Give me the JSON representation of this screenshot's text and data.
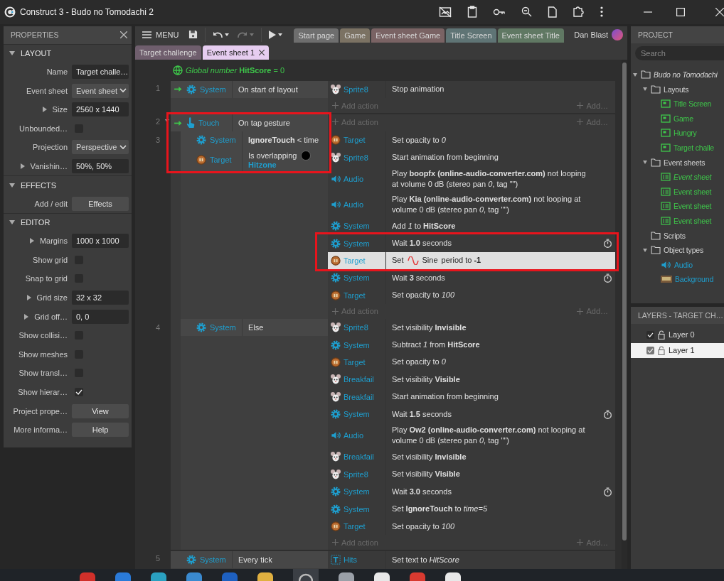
{
  "window": {
    "title": "Construct 3 - Budo no Tomodachi 2"
  },
  "properties": {
    "title": "PROPERTIES",
    "sections": [
      {
        "title": "LAYOUT",
        "expanded": true,
        "rows": [
          {
            "label": "Name",
            "kind": "field",
            "value": "Target challe…"
          },
          {
            "label": "Event sheet",
            "kind": "select",
            "value": "Event sheet"
          },
          {
            "label": "Size",
            "kind": "field",
            "value": "2560 x 1440",
            "expandable": true
          },
          {
            "label": "Unbounded…",
            "kind": "check",
            "checked": false
          },
          {
            "label": "Projection",
            "kind": "select",
            "value": "Perspective"
          },
          {
            "label": "Vanishin…",
            "kind": "field",
            "value": "50%, 50%",
            "expandable": true
          }
        ]
      },
      {
        "title": "EFFECTS",
        "expanded": true,
        "rows": [
          {
            "label": "Add / edit",
            "kind": "button",
            "value": "Effects"
          }
        ]
      },
      {
        "title": "EDITOR",
        "expanded": true,
        "rows": [
          {
            "label": "Margins",
            "kind": "field",
            "value": "1000 x 1000",
            "expandable": true
          },
          {
            "label": "Show grid",
            "kind": "check",
            "checked": false
          },
          {
            "label": "Snap to grid",
            "kind": "check",
            "checked": false
          },
          {
            "label": "Grid size",
            "kind": "field",
            "value": "32 x 32",
            "expandable": true
          },
          {
            "label": "Grid off…",
            "kind": "field",
            "value": "0, 0",
            "expandable": true
          },
          {
            "label": "Show collisi…",
            "kind": "check",
            "checked": false
          },
          {
            "label": "Show meshes",
            "kind": "check",
            "checked": false
          },
          {
            "label": "Show transl…",
            "kind": "check",
            "checked": false
          },
          {
            "label": "Show hierar…",
            "kind": "check",
            "checked": true
          },
          {
            "label": "Project prope…",
            "kind": "button",
            "value": "View"
          },
          {
            "label": "More informa…",
            "kind": "button",
            "value": "Help"
          }
        ]
      }
    ]
  },
  "toolbar": {
    "menu": "MENU",
    "undo_disabled": false,
    "redo_disabled": true,
    "user": "Dan Blast",
    "tab_rows": [
      {
        "tabs": [
          {
            "label": "Start page",
            "color": "#6e6e6e",
            "selected": false,
            "closable": false
          },
          {
            "label": "Game",
            "color": "#7b7263",
            "selected": false,
            "closable": false
          },
          {
            "label": "Event sheet Game",
            "color": "#7a6364",
            "selected": false,
            "closable": false
          },
          {
            "label": "Title Screen",
            "color": "#5f7475",
            "selected": false,
            "closable": false
          },
          {
            "label": "Event sheet Title",
            "color": "#607863",
            "selected": false,
            "closable": false
          }
        ]
      },
      {
        "tabs": [
          {
            "label": "Target challenge",
            "color": "#6f5e6d",
            "selected": false,
            "closable": false
          },
          {
            "label": "Event sheet 1",
            "color": "#e6cdf0",
            "selected": true,
            "closable": true
          }
        ]
      }
    ]
  },
  "sheet": {
    "global": "*Global number* **HitScore** = 0",
    "events": [
      {
        "number": "1",
        "conditions": [
          {
            "kind": "system",
            "object": "System",
            "text": "On start of layout",
            "trigger": true
          }
        ],
        "actions": [
          {
            "kind": "character",
            "object": "Sprite8",
            "text": "Stop animation",
            "selected": false
          }
        ],
        "add_action": "Add action",
        "add_other": "Add…"
      },
      {
        "number": "2",
        "expanded": true,
        "conditions": [
          {
            "kind": "touch",
            "object": "Touch",
            "text": "On tap gesture",
            "trigger": true,
            "highlighted": true
          }
        ],
        "add_action": "Add action",
        "add_other": "Add…",
        "children": [
          {
            "number": "3",
            "conditions": [
              {
                "kind": "system",
                "object": "System",
                "text": "**IgnoreTouch** < time",
                "trigger": false,
                "highlighted": true
              },
              {
                "kind": "token",
                "object": "Target",
                "text": "Is overlapping",
                "object_param": "Hitzone",
                "trigger": false,
                "highlighted": true
              }
            ],
            "actions": [
              {
                "kind": "token",
                "object": "Target",
                "text": "Set opacity to *0*",
                "selected": false
              },
              {
                "kind": "character",
                "object": "Sprite8",
                "text": "Start animation from beginning",
                "selected": false
              },
              {
                "kind": "audio",
                "object": "Audio",
                "text": "Play **boopfx (online-audio-converter.com)** not looping at volume 0 dB (stereo pan *0*, tag \"\")",
                "selected": false
              },
              {
                "kind": "audio",
                "object": "Audio",
                "text": "Play **Kia (online-audio-converter.com)** not looping at volume 0 dB (stereo pan *0*, tag \"\")",
                "selected": false
              },
              {
                "kind": "system",
                "object": "System",
                "text": "Add *1* to **HitScore**",
                "selected": false
              },
              {
                "kind": "system",
                "object": "System",
                "text": "Wait **1.0** seconds",
                "timer": true,
                "selected": false,
                "highlighted": true
              },
              {
                "kind": "token",
                "object": "Target",
                "text": "Set",
                "behavior": "Sine",
                "text_after": "period to **-1**",
                "selected": true,
                "highlighted": true
              },
              {
                "kind": "system",
                "object": "System",
                "text": "Wait **3** seconds",
                "timer": true,
                "selected": false
              },
              {
                "kind": "token",
                "object": "Target",
                "text": "Set opacity to *100*",
                "selected": false
              }
            ],
            "add_action": "Add action",
            "add_other": "Add…"
          },
          {
            "number": "4",
            "conditions": [
              {
                "kind": "system",
                "object": "System",
                "text": "Else",
                "trigger": false
              }
            ],
            "actions": [
              {
                "kind": "character",
                "object": "Sprite8",
                "text": "Set visibility **Invisible**",
                "selected": false
              },
              {
                "kind": "system",
                "object": "System",
                "text": "Subtract *1* from **HitScore**",
                "selected": false
              },
              {
                "kind": "token",
                "object": "Target",
                "text": "Set opacity to *0*",
                "selected": false
              },
              {
                "kind": "character",
                "object": "Breakfail",
                "text": "Set visibility **Visible**",
                "selected": false
              },
              {
                "kind": "character",
                "object": "Breakfail",
                "text": "Start animation from beginning",
                "selected": false
              },
              {
                "kind": "system",
                "object": "System",
                "text": "Wait **1.5** seconds",
                "timer": true,
                "selected": false
              },
              {
                "kind": "audio",
                "object": "Audio",
                "text": "Play **Ow2 (online-audio-converter.com)** not looping at volume 0 dB (stereo pan *0*, tag \"\")",
                "selected": false
              },
              {
                "kind": "character",
                "object": "Breakfail",
                "text": "Set visibility **Invisible**",
                "selected": false
              },
              {
                "kind": "character",
                "object": "Sprite8",
                "text": "Set visibility **Visible**",
                "selected": false
              },
              {
                "kind": "system",
                "object": "System",
                "text": "Wait **3.0** seconds",
                "timer": true,
                "selected": false
              },
              {
                "kind": "system",
                "object": "System",
                "text": "Set **IgnoreTouch** to *time=5*",
                "selected": false
              },
              {
                "kind": "token",
                "object": "Target",
                "text": "Set opacity to *100*",
                "selected": false
              }
            ],
            "add_action": "Add action",
            "add_other": "Add…"
          }
        ]
      },
      {
        "number": "5",
        "conditions": [
          {
            "kind": "system",
            "object": "System",
            "text": "Every tick",
            "trigger": false
          }
        ],
        "actions": [
          {
            "kind": "text",
            "object": "Hits",
            "text": "Set text to *HitScore*",
            "selected": false
          }
        ]
      }
    ]
  },
  "project": {
    "title": "PROJECT",
    "search_placeholder": "Search",
    "tree": [
      {
        "label": "Budo no Tomodachi",
        "kind": "project",
        "expanded": true,
        "children": [
          {
            "label": "Layouts",
            "kind": "folder",
            "expanded": true,
            "children": [
              {
                "label": "Title Screen",
                "kind": "layout"
              },
              {
                "label": "Game",
                "kind": "layout"
              },
              {
                "label": "Hungry",
                "kind": "layout"
              },
              {
                "label": "Target challe",
                "kind": "layout"
              }
            ]
          },
          {
            "label": "Event sheets",
            "kind": "folder",
            "expanded": true,
            "children": [
              {
                "label": "Event sheet",
                "kind": "sheet",
                "active": true
              },
              {
                "label": "Event sheet",
                "kind": "sheet",
                "active": false
              },
              {
                "label": "Event sheet",
                "kind": "sheet",
                "active": false
              },
              {
                "label": "Event sheet",
                "kind": "sheet",
                "active": false
              }
            ]
          },
          {
            "label": "Scripts",
            "kind": "folder"
          },
          {
            "label": "Object types",
            "kind": "folder",
            "expanded": true,
            "children": [
              {
                "label": "Audio",
                "kind": "audio"
              },
              {
                "label": "Background",
                "kind": "image"
              }
            ]
          }
        ]
      }
    ]
  },
  "layers": {
    "title": "LAYERS - TARGET CH…",
    "layers": [
      {
        "name": "Layer 0",
        "visible": true,
        "locked": false,
        "selected": false
      },
      {
        "name": "Layer 1",
        "visible": true,
        "locked": false,
        "selected": true
      }
    ]
  }
}
